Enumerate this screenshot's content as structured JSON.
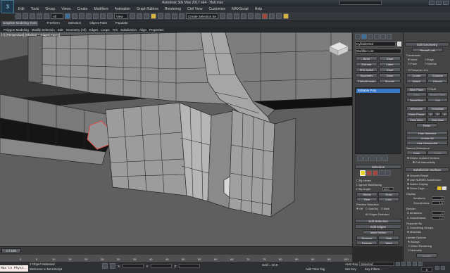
{
  "app": {
    "title": "Autodesk 3ds Max 2017 x64 - Hull.max",
    "window_buttons": [
      "minimize",
      "maximize",
      "close"
    ]
  },
  "menu": [
    "Edit",
    "Tools",
    "Group",
    "Views",
    "Create",
    "Modifiers",
    "Animation",
    "Graph Editors",
    "Rendering",
    "Civil View",
    "Customize",
    "MAXScript",
    "Help"
  ],
  "toolbar": {
    "selection_filter": "All",
    "reference_coord": "View",
    "named_selection": "Create Selection Se"
  },
  "ribbon": {
    "tabs": [
      "Graphite Modeling Tools",
      "Freeform",
      "Selection",
      "Object Paint",
      "Populate"
    ],
    "subtabs": [
      "Polygon Modeling",
      "Modify Selection",
      "Edit",
      "Geometry (All)",
      "Edges",
      "Loops",
      "Tris",
      "Subdivision",
      "Align",
      "Properties"
    ]
  },
  "viewport": {
    "label": "[+] [Perspective] [Shaded + Edged Faces]",
    "colors": {
      "background": "#5f5f5f",
      "mesh": "#8e8e8e",
      "edge": "#262626",
      "selected": "#e05050"
    }
  },
  "command_panel": {
    "object_name": "Cylinder015",
    "modifier_list": "Modifier List",
    "modifier_buttons": [
      [
        "Bend",
        "Shell"
      ],
      [
        "Extrude",
        "Lathe"
      ],
      [
        "FFD 3x3x3",
        "Shell"
      ],
      [
        "Symmetry",
        "Taper"
      ],
      [
        "TurboSmooth",
        "Smooth"
      ]
    ],
    "stack_item": "Editable Poly",
    "selection": {
      "header": "Selection",
      "by_vertex": "By Vertex",
      "ignore_backfacing": "Ignore Backfacing",
      "by_angle": "By Angle:",
      "angle_value": "45.0",
      "shrink": "Shrink",
      "grow": "Grow",
      "ring": "Ring",
      "loop": "Loop",
      "preview": "Preview Selection",
      "off": "Off",
      "subobj": "SubObj",
      "multi": "Multi",
      "status": "60 Edges Selected"
    },
    "soft_selection": "Soft Selection",
    "edit_edges": {
      "header": "Edit Edges",
      "insert_vertex": "Insert Vertex",
      "buttons": [
        [
          "Remove",
          "Split"
        ],
        [
          "Extrude",
          "Weld"
        ],
        [
          "Chamfer",
          "Target Weld"
        ],
        [
          "Bridge",
          "Connect"
        ]
      ],
      "create_shape": "Create Shape From Selection",
      "weight_label": "Weight:",
      "weight_value": "1.0",
      "crease_label": "Crease:",
      "crease_value": "0.0"
    }
  },
  "edit_geometry": {
    "header": "Edit Geometry",
    "repeat_last": "Repeat Last",
    "constraints": "Constraints",
    "none": "None",
    "edge": "Edge",
    "face": "Face",
    "normal": "Normal",
    "preserve_uvs": "Preserve UVs",
    "create": "Create",
    "collapse": "Collapse",
    "attach": "Attach",
    "detach": "Detach",
    "slice_plane": "Slice Plane",
    "split": "Split",
    "slice": "Slice",
    "reset_plane": "Reset Plane",
    "quickslice": "QuickSlice",
    "cut": "Cut",
    "msmooth": "MSmooth",
    "tessellate": "Tessellate",
    "make_planar": "Make Planar",
    "x": "X",
    "y": "Y",
    "z": "Z",
    "view_align": "View Align",
    "grid_align": "Grid Align",
    "relax": "Relax",
    "hide_selected": "Hide Selected",
    "unhide_all": "Unhide All",
    "hide_unselected": "Hide Unselected",
    "named_selections": "Named Selections:",
    "copy": "Copy",
    "paste": "Paste",
    "delete_isolated": "Delete Isolated Vertices",
    "full_interactivity": "Full Interactivity"
  },
  "subdivision": {
    "header": "Subdivision Surface",
    "smooth_result": "Smooth Result",
    "use_nurms": "Use NURMS Subdivision",
    "isoline": "Isoline Display",
    "show_cage": "Show Cage......",
    "display": "Display",
    "iterations_label": "Iterations:",
    "iterations_value": "1",
    "smoothness_label": "Smoothness:",
    "smoothness_value": "1.0",
    "render": "Render",
    "r_iterations_value": "0",
    "r_smoothness_value": "1.0",
    "separate_by": "Separate By",
    "smoothing_groups": "Smoothing Groups",
    "materials": "Materials",
    "update_options": "Update Options",
    "always": "Always",
    "when_rendering": "When Rendering",
    "manually": "Manually",
    "update": "Update",
    "cage_colors": [
      "#e8c020",
      "#e0e0e0"
    ]
  },
  "timeline": {
    "frame": "0 / 100",
    "ticks": [
      "0",
      "5",
      "10",
      "15",
      "20",
      "25",
      "30",
      "35",
      "40",
      "45",
      "50",
      "55",
      "60",
      "65",
      "70",
      "75",
      "80",
      "85",
      "90",
      "95",
      "100"
    ]
  },
  "status": {
    "maxscript": "Max to Physc.",
    "selection": "1 Object Selected",
    "prompt": "Welcome to MAXScript",
    "x_label": "X:",
    "y_label": "Y:",
    "z_label": "Z:",
    "grid": "Grid = 10.0",
    "add_time_tag": "Add Time Tag",
    "auto_key": "Auto Key",
    "selected": "Selected",
    "set_key": "Set Key",
    "key_filters": "Key Filters...",
    "frame": "0"
  }
}
